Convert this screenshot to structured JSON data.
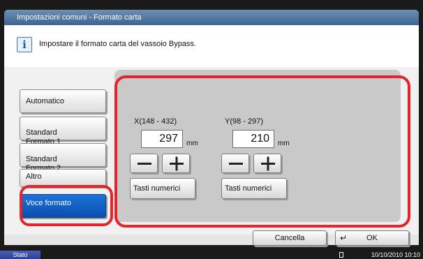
{
  "window": {
    "title": "Impostazioni comuni - Formato carta"
  },
  "info": {
    "icon": "info-icon",
    "message": "Impostare il formato carta del vassoio Bypass."
  },
  "sidebar": {
    "items": [
      {
        "label": "Automatico",
        "selected": false
      },
      {
        "label": "Standard\nFormato 1",
        "selected": false
      },
      {
        "label": "Standard\nFormato 2",
        "selected": false
      },
      {
        "label": "Altro",
        "selected": false
      },
      {
        "label": "Voce formato",
        "selected": true
      }
    ]
  },
  "size_entry": {
    "x": {
      "label": "X(148 - 432)",
      "value": "297",
      "unit": "mm",
      "numeric_keys_label": "Tasti numerici"
    },
    "y": {
      "label": "Y(98 - 297)",
      "value": "210",
      "unit": "mm",
      "numeric_keys_label": "Tasti numerici"
    }
  },
  "footer": {
    "cancel_label": "Cancella",
    "ok_label": "OK"
  },
  "status": {
    "stato_label": "Stato",
    "datetime": "10/10/2010  10:10"
  },
  "colors": {
    "selected_button": "#0b4fb0",
    "highlight_ring": "#e3242b",
    "title_bar": "#3e6591"
  }
}
